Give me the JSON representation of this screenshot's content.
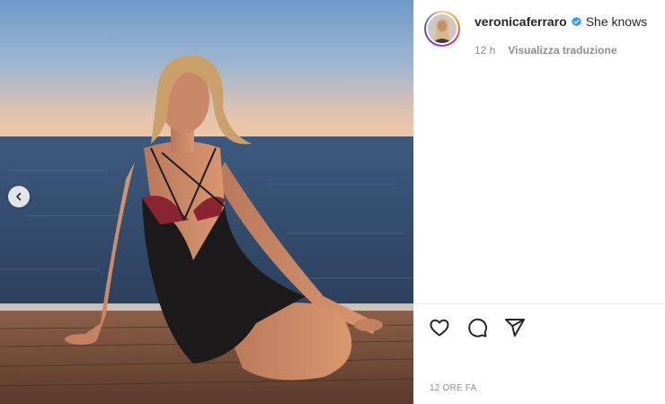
{
  "post": {
    "username": "veronicaferraro",
    "caption": "She knows",
    "age_short": "12 h",
    "see_translation": "Visualizza traduzione",
    "timestamp": "12 ORE FA"
  },
  "icons": {
    "previous": "chevron-left-icon",
    "verified": "verified-badge-icon",
    "like": "heart-icon",
    "comment": "comment-icon",
    "share": "send-icon"
  },
  "colors": {
    "verified": "#3897f0",
    "text": "#262626",
    "muted": "#8e8e8e"
  }
}
